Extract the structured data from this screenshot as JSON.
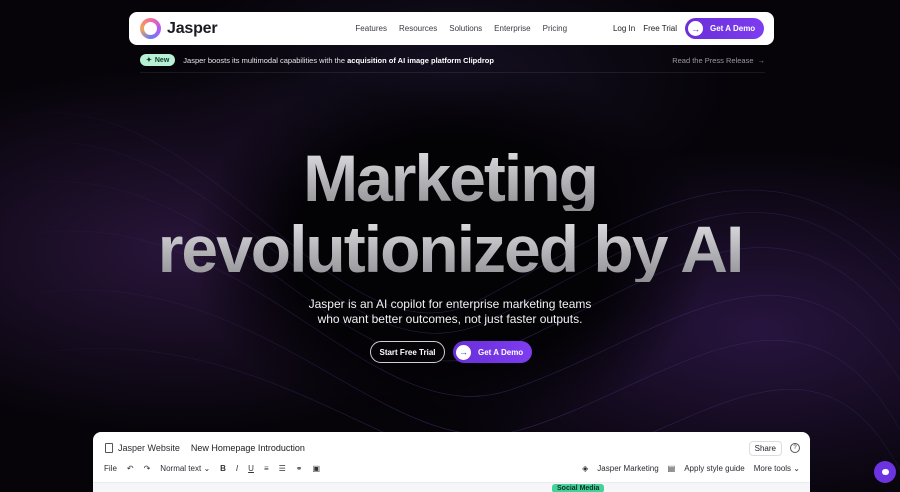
{
  "brand": {
    "name": "Jasper"
  },
  "nav": {
    "links": [
      "Features",
      "Resources",
      "Solutions",
      "Enterprise",
      "Pricing"
    ],
    "login": "Log In",
    "free_trial": "Free Trial",
    "demo": "Get A Demo"
  },
  "announcement": {
    "badge": "New",
    "text": "Jasper boosts its multimodal capabilities with the ",
    "bold": "acquisition of AI image platform Clipdrop",
    "link": "Read the Press Release"
  },
  "hero": {
    "line1": "Marketing",
    "line2": "revolutionized by AI",
    "sub1": "Jasper is an AI copilot for enterprise marketing teams",
    "sub2": "who want better outcomes, not just faster outputs.",
    "trial_button": "Start Free Trial",
    "demo_button": "Get A Demo"
  },
  "editor": {
    "workspace": "Jasper Website",
    "doc_title": "New Homepage Introduction",
    "share": "Share",
    "file_menu": "File",
    "text_style": "Normal text",
    "jasper_marketing": "Jasper Marketing",
    "apply_style": "Apply style guide",
    "more_tools": "More tools",
    "tag": "Social Media"
  },
  "colors": {
    "accent": "#6a2fd9",
    "badge": "#b7f0d4",
    "tag": "#44d29a"
  }
}
